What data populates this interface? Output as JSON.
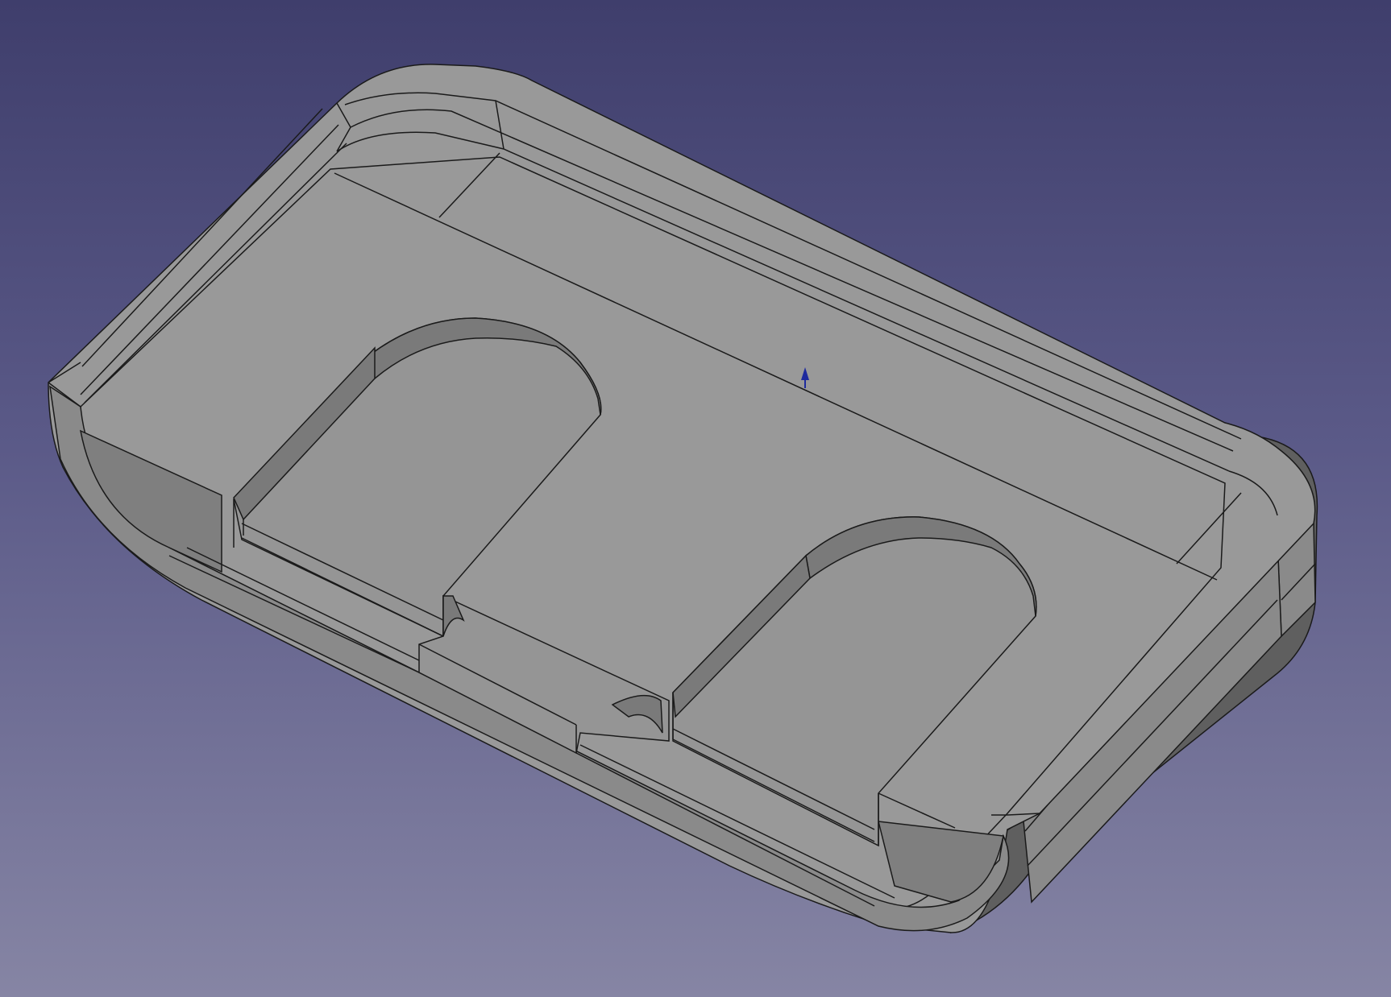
{
  "viewport": {
    "projection": "isometric",
    "background_top": "#3f3e6c",
    "background_bottom": "#8685a4"
  },
  "model": {
    "face_color": "#999999",
    "side_color": "#8a8a8a",
    "dark_side_color": "#6b6b6b",
    "edge_color": "#1a1a1a",
    "pockets": 2
  },
  "axis_marker": {
    "icon": "z-axis-arrow-icon",
    "color": "#1e2a9e"
  }
}
